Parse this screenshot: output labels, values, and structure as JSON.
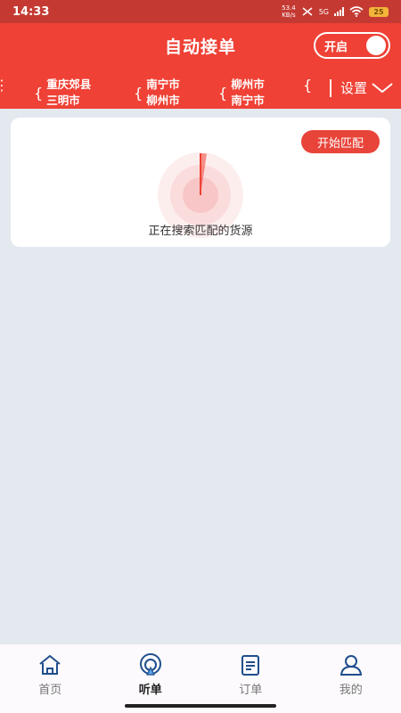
{
  "status_bar": {
    "time": "14:33",
    "speed_value": "53.4",
    "speed_unit": "KB/s",
    "network": "5G",
    "battery": "25"
  },
  "header": {
    "title": "自动接单",
    "toggle_label": "开启"
  },
  "routes": [
    {
      "from": "重庆郊县",
      "to": "三明市"
    },
    {
      "from": "南宁市",
      "to": "柳州市"
    },
    {
      "from": "柳州市",
      "to": "南宁市"
    }
  ],
  "settings_label": "设置",
  "card": {
    "start_button": "开始匹配",
    "searching_text": "正在搜索匹配的货源"
  },
  "nav": {
    "items": [
      {
        "label": "首页",
        "icon": "home-icon"
      },
      {
        "label": "听单",
        "icon": "listen-icon"
      },
      {
        "label": "订单",
        "icon": "order-icon"
      },
      {
        "label": "我的",
        "icon": "profile-icon"
      }
    ],
    "active": "听单"
  },
  "colors": {
    "primary": "#ef4135",
    "status_bar": "#c43a33",
    "background": "#e4e8ef"
  }
}
